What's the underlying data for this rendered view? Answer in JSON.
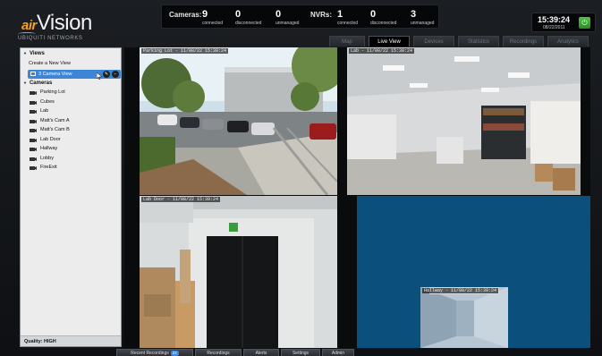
{
  "brand": {
    "prefix": "air",
    "name": "Vision",
    "company": "UBIQUITI NETWORKS"
  },
  "stats": {
    "cameras": {
      "label": "Cameras:",
      "connected": "9",
      "disconnected": "0",
      "unmanaged": "0"
    },
    "nvrs": {
      "label": "NVRs:",
      "connected": "1",
      "disconnected": "0",
      "unmanaged": "3"
    },
    "sub_connected": "connected",
    "sub_disconnected": "disconnected",
    "sub_unmanaged": "unmanaged"
  },
  "clock": {
    "time": "15:39:24",
    "date": "08/22/2011"
  },
  "tabs": [
    "Map",
    "Live View",
    "Devices",
    "Statistics",
    "Recordings",
    "Analytics"
  ],
  "active_tab": "Live View",
  "sidebar": {
    "views_heading": "Views",
    "create_view": "Create a New View",
    "selected_view": "3 Camera View",
    "cameras_heading": "Cameras",
    "cameras": [
      "Parking Lot",
      "Cubes",
      "Lab",
      "Matt's Cam A",
      "Matt's Cam B",
      "Lab Door",
      "Hallway",
      "Lobby",
      "FireExit"
    ],
    "quality": "Quality: HIGH"
  },
  "feeds": [
    {
      "name": "parking-lot",
      "label": "Parking Lot - 11/08/22 15:39:24"
    },
    {
      "name": "lab",
      "label": "Lab - 11/08/22 15:39:24"
    },
    {
      "name": "lab-door",
      "label": "Lab Door - 11/08/22 15:39:24"
    },
    {
      "name": "hallway",
      "label": "Hallway - 11/08/22 15:39:24"
    }
  ],
  "bottom_bar": {
    "recent_recordings": "Recent Recordings",
    "recent_count": "22",
    "recordings": "Recordings",
    "alerts": "Alerts",
    "settings": "Settings",
    "admin": "Admin"
  },
  "colors": {
    "accent": "#3d86d6",
    "power": "#3aa832",
    "empty_cell": "#0b4f7d",
    "brand_orange": "#f7a21c"
  }
}
